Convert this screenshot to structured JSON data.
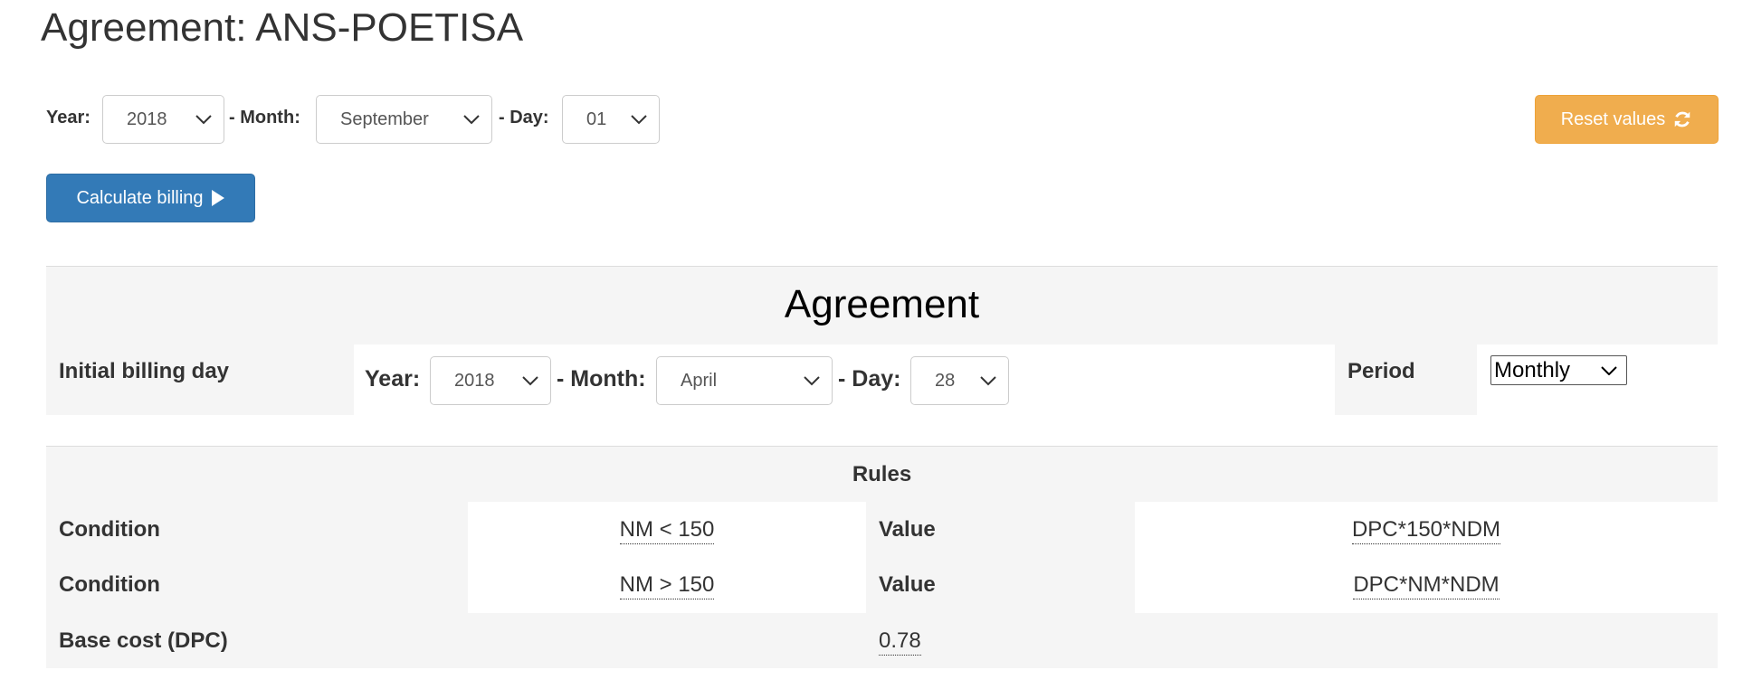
{
  "page": {
    "title": "Agreement: ANS-POETISA"
  },
  "date_filter": {
    "year_label": "Year:",
    "year_value": "2018",
    "month_label": "- Month:",
    "month_value": "September",
    "day_label": "- Day:",
    "day_value": "01"
  },
  "buttons": {
    "reset_label": "Reset values",
    "calculate_label": "Calculate billing"
  },
  "agreement": {
    "heading": "Agreement",
    "initial_billing_label": "Initial billing day",
    "year_label": "Year:",
    "year_value": "2018",
    "month_label": "- Month:",
    "month_value": "April",
    "day_label": "- Day:",
    "day_value": "28",
    "period_label": "Period",
    "period_value": "Monthly"
  },
  "rules": {
    "heading": "Rules",
    "rows": [
      {
        "condition_label": "Condition",
        "condition": "NM < 150",
        "value_label": "Value",
        "value": "DPC*150*NDM"
      },
      {
        "condition_label": "Condition",
        "condition": "NM > 150",
        "value_label": "Value",
        "value": "DPC*NM*NDM"
      }
    ],
    "base_cost_label": "Base cost (DPC)",
    "base_cost_value": "0.78"
  },
  "colors": {
    "primary": "#337ab7",
    "warning": "#f0ad4e",
    "panel": "#f5f5f5"
  }
}
